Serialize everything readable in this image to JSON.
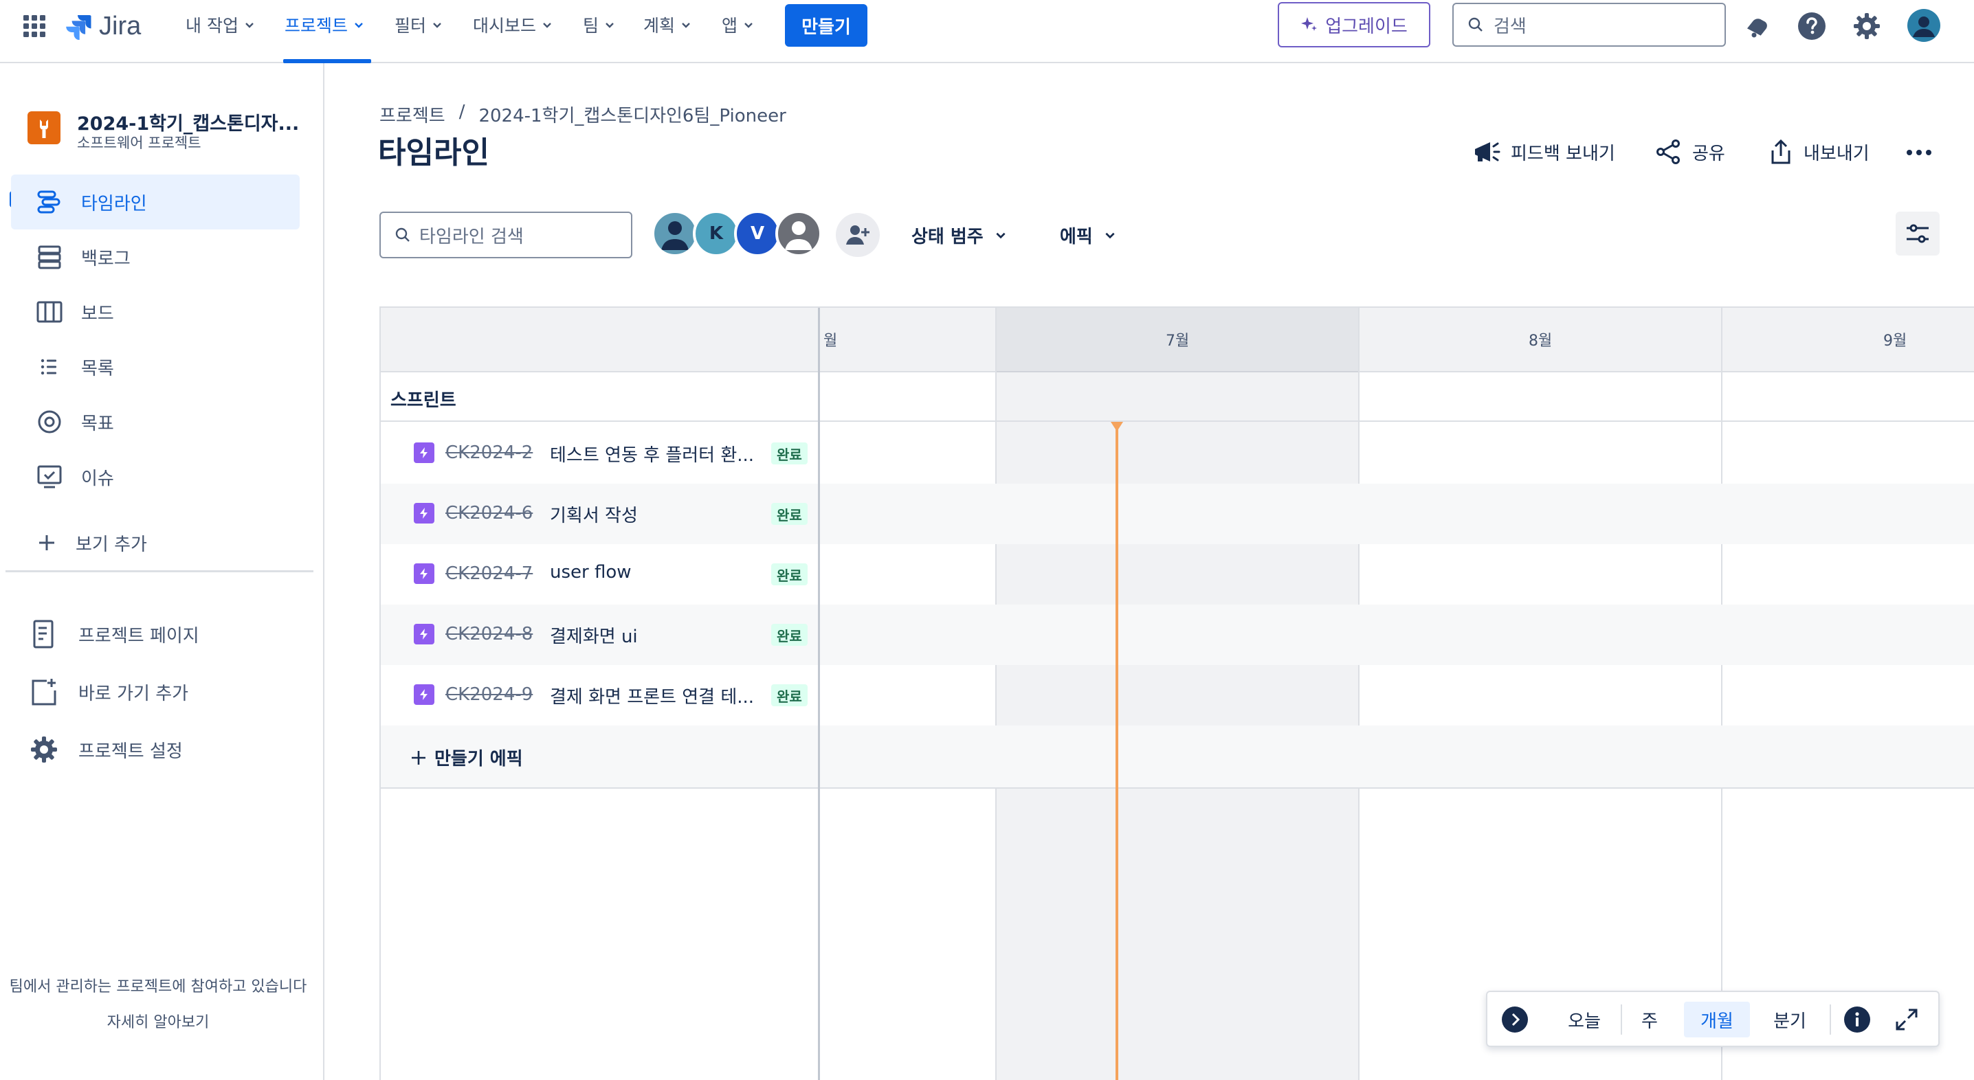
{
  "app": {
    "name": "Jira"
  },
  "topnav": {
    "items": [
      {
        "label": "내 작업"
      },
      {
        "label": "프로젝트",
        "active": true
      },
      {
        "label": "필터"
      },
      {
        "label": "대시보드"
      },
      {
        "label": "팀"
      },
      {
        "label": "계획"
      },
      {
        "label": "앱"
      }
    ],
    "create_label": "만들기",
    "upgrade_label": "업그레이드",
    "search_placeholder": "검색",
    "icons": [
      "app-switcher-icon",
      "notifications-icon",
      "help-icon",
      "settings-icon",
      "profile-avatar-icon"
    ]
  },
  "sidebar": {
    "project_name": "2024-1학기_캡스톤디자...",
    "project_type": "소프트웨어 프로젝트",
    "items": [
      {
        "label": "타임라인",
        "icon": "timeline-icon",
        "active": true
      },
      {
        "label": "백로그",
        "icon": "backlog-icon"
      },
      {
        "label": "보드",
        "icon": "board-icon"
      },
      {
        "label": "목록",
        "icon": "list-icon"
      },
      {
        "label": "목표",
        "icon": "goals-icon"
      },
      {
        "label": "이슈",
        "icon": "issues-icon"
      }
    ],
    "add_view_label": "보기 추가",
    "secondary": [
      {
        "label": "프로젝트 페이지",
        "icon": "project-page-icon"
      },
      {
        "label": "바로 가기 추가",
        "icon": "add-shortcut-icon"
      },
      {
        "label": "프로젝트 설정",
        "icon": "project-settings-icon"
      }
    ],
    "footer_text": "팀에서 관리하는 프로젝트에 참여하고 있습니다",
    "footer_link": "자세히 알아보기"
  },
  "header": {
    "breadcrumb": [
      "프로젝트",
      "/",
      "2024-1학기_캡스톤디자인6팀_Pioneer"
    ],
    "title": "타임라인",
    "actions": {
      "feedback": "피드백 보내기",
      "share": "공유",
      "export": "내보내기"
    }
  },
  "toolbar": {
    "search_placeholder": "타임라인 검색",
    "avatars": [
      {
        "initial": "",
        "color": "#5e9bb5"
      },
      {
        "initial": "K",
        "color": "#4fa3c0"
      },
      {
        "initial": "V",
        "color": "#1d54c9"
      },
      {
        "initial": "",
        "color": "#6b6e76"
      }
    ],
    "filters": {
      "status_category": "상태 범주",
      "epic": "에픽"
    }
  },
  "timeline": {
    "months": [
      {
        "label": "월"
      },
      {
        "label": "7월"
      },
      {
        "label": "8월"
      },
      {
        "label": "9월"
      }
    ],
    "sprint_label": "스프린트",
    "issues": [
      {
        "key": "CK2024-2",
        "summary": "테스트 연동 후 플러터 환...",
        "status": "완료"
      },
      {
        "key": "CK2024-6",
        "summary": "기획서 작성",
        "status": "완료"
      },
      {
        "key": "CK2024-7",
        "summary": "user flow",
        "status": "완료"
      },
      {
        "key": "CK2024-8",
        "summary": "결제화면 ui",
        "status": "완료"
      },
      {
        "key": "CK2024-9",
        "summary": "결제 화면 프론트 연결 테...",
        "status": "완료"
      }
    ],
    "create_epic_label": "만들기 에픽"
  },
  "zoom": {
    "today": "오늘",
    "week": "주",
    "month": "개월",
    "quarter": "분기",
    "active": "개월"
  },
  "colors": {
    "primary": "#0c66e4",
    "upgrade": "#5e4db2",
    "today_line": "#f5a35c",
    "epic_icon": "#8f5cf0",
    "done_badge_bg": "#dcfff1",
    "done_badge_text": "#216e4e"
  }
}
